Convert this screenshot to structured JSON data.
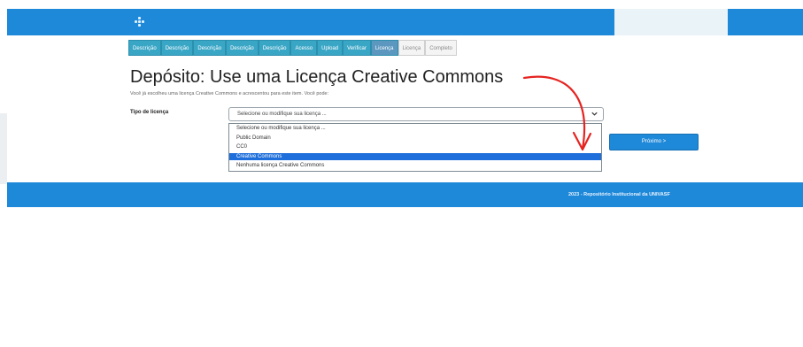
{
  "header": {
    "logo_icon": "repository-logo-icon",
    "accent_color": "#1e88d9"
  },
  "steps": [
    {
      "label": "Descrição",
      "state": "done"
    },
    {
      "label": "Descrição",
      "state": "done"
    },
    {
      "label": "Descrição",
      "state": "done"
    },
    {
      "label": "Descrição",
      "state": "done"
    },
    {
      "label": "Descrição",
      "state": "done"
    },
    {
      "label": "Acesso",
      "state": "done"
    },
    {
      "label": "Upload",
      "state": "done"
    },
    {
      "label": "Verificar",
      "state": "done"
    },
    {
      "label": "Licença",
      "state": "active"
    },
    {
      "label": "Licença",
      "state": "future"
    },
    {
      "label": "Completo",
      "state": "future"
    }
  ],
  "page": {
    "title": "Depósito: Use uma Licença Creative Commons",
    "subtitle": "Você já escolheu uma licença Creative Commons e acrescentou para este item. Você pode:"
  },
  "license_field": {
    "label": "Tipo de licença",
    "selected_value": "Selecione ou modifique sua licença ...",
    "options": [
      "Selecione ou modifique sua licença ...",
      "Public Domain",
      "CC0",
      "Creative Commons",
      "Nenhuma licença Creative Commons"
    ],
    "highlighted_option": "Creative Commons"
  },
  "actions": {
    "next_label": "Próximo >"
  },
  "footer": {
    "text": "2023 - Repositório Institucional da UNIVASF"
  },
  "annotation": {
    "color": "#e52421",
    "icon": "curved-arrow-icon"
  }
}
